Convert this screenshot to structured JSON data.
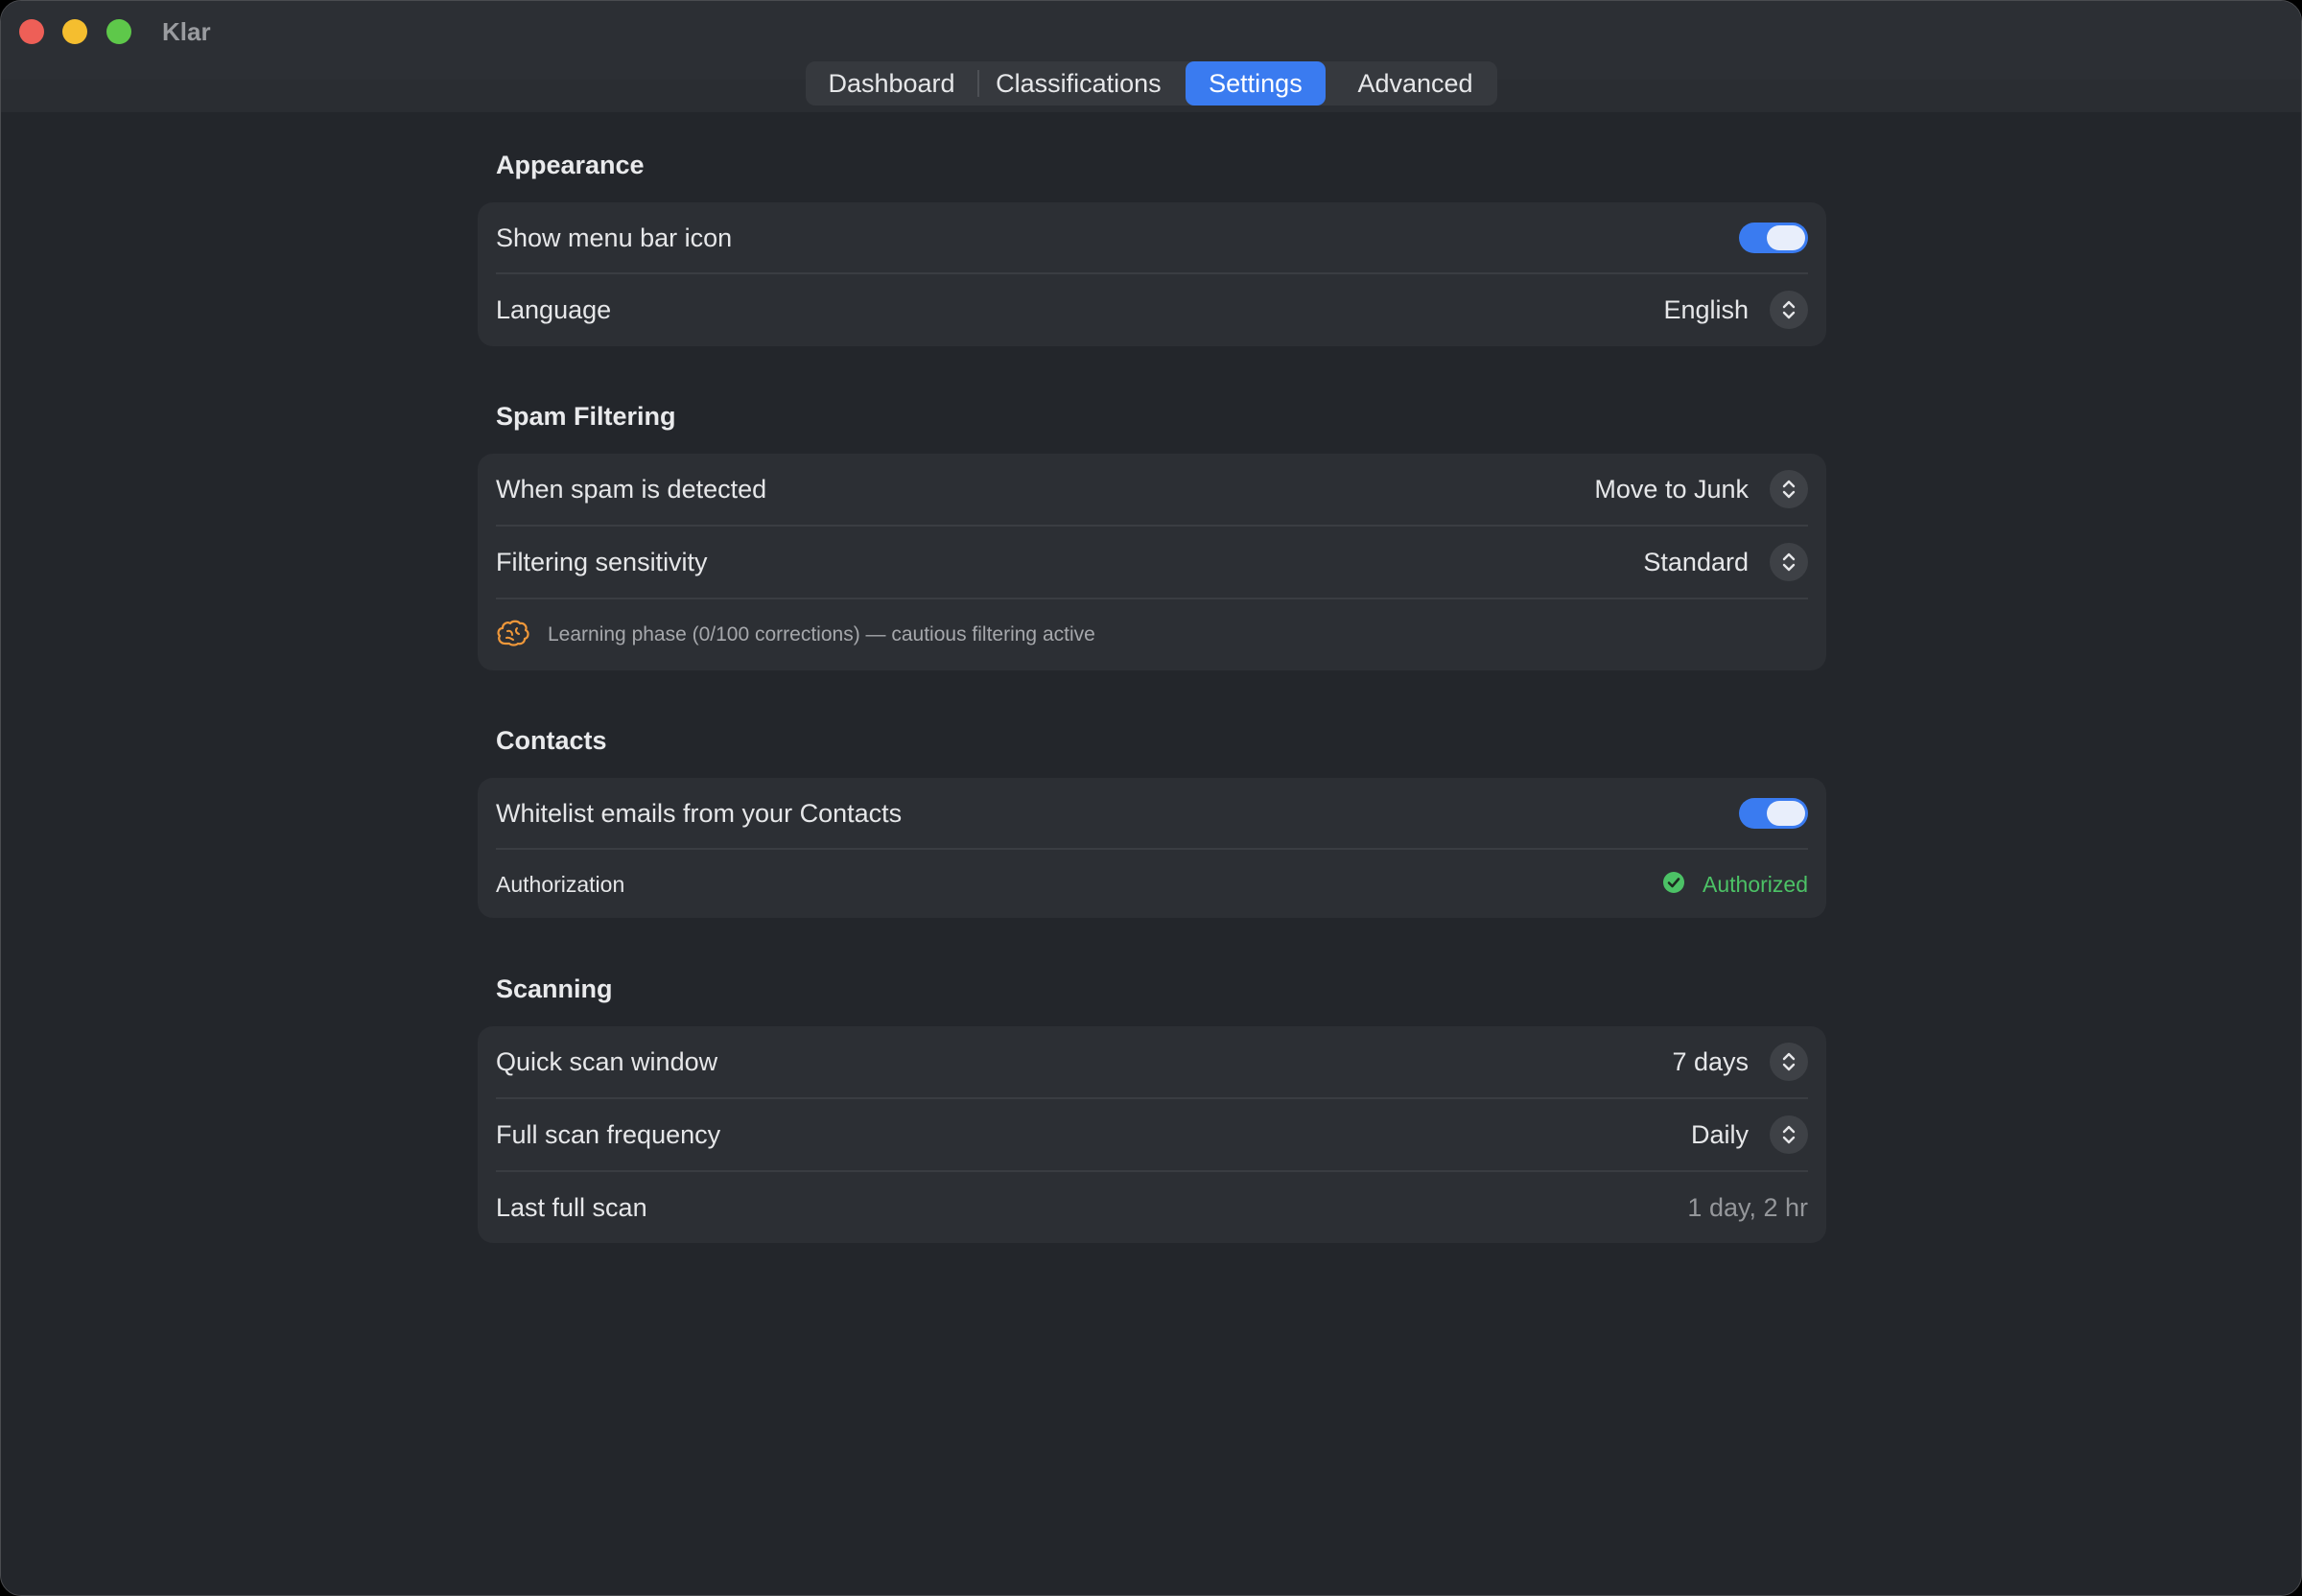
{
  "window": {
    "app_title": "Klar",
    "traffic_colors": {
      "close": "#ee5f57",
      "minimize": "#f5be2f",
      "maximize": "#5ec84a"
    }
  },
  "tabs": [
    {
      "label": "Dashboard",
      "selected": false
    },
    {
      "label": "Classifications",
      "selected": false
    },
    {
      "label": "Settings",
      "selected": true
    },
    {
      "label": "Advanced",
      "selected": false
    }
  ],
  "appearance": {
    "title": "Appearance",
    "show_menu_bar_icon": {
      "label": "Show menu bar icon",
      "on": true
    },
    "language": {
      "label": "Language",
      "value": "English"
    }
  },
  "spam_filtering": {
    "title": "Spam Filtering",
    "when_detected": {
      "label": "When spam is detected",
      "value": "Move to Junk"
    },
    "sensitivity": {
      "label": "Filtering sensitivity",
      "value": "Standard"
    },
    "learning_note": "Learning phase (0/100 corrections) — cautious filtering active",
    "note_icon": "brain-icon"
  },
  "contacts": {
    "title": "Contacts",
    "whitelist": {
      "label": "Whitelist emails from your Contacts",
      "on": true
    },
    "authorization": {
      "label": "Authorization",
      "status": "Authorized",
      "icon": "checkmark-circle-icon"
    }
  },
  "scanning": {
    "title": "Scanning",
    "quick_scan": {
      "label": "Quick scan window",
      "value": "7 days"
    },
    "full_scan_frequency": {
      "label": "Full scan frequency",
      "value": "Daily"
    },
    "last_full_scan": {
      "label": "Last full scan",
      "value": "1 day, 2 hr"
    }
  },
  "colors": {
    "accent": "#3a7bf0",
    "authorized_green": "#4cc266",
    "learning_orange": "#f0983a"
  }
}
